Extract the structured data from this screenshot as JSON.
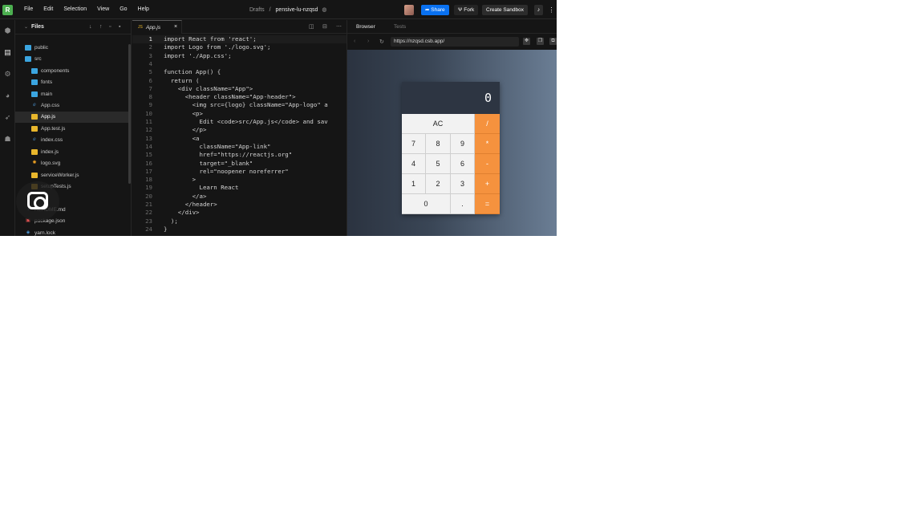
{
  "menubar": {
    "logo": "R",
    "menu": [
      "File",
      "Edit",
      "Selection",
      "View",
      "Go",
      "Help"
    ],
    "folder": "Drafts",
    "separator": "/",
    "sandbox_name": "pensive-lu-nzqsd",
    "share_label": "Share",
    "fork_label": "Fork",
    "create_label": "Create Sandbox"
  },
  "explorer": {
    "title": "Files",
    "items": [
      {
        "label": "public",
        "type": "folder"
      },
      {
        "label": "src",
        "type": "folder"
      },
      {
        "label": "components",
        "type": "folder"
      },
      {
        "label": "fonts",
        "type": "folder"
      },
      {
        "label": "main",
        "type": "folder"
      },
      {
        "label": "App.css",
        "type": "css"
      },
      {
        "label": "App.js",
        "type": "js"
      },
      {
        "label": "App.test.js",
        "type": "js"
      },
      {
        "label": "index.css",
        "type": "css"
      },
      {
        "label": "index.js",
        "type": "js"
      },
      {
        "label": "logo.svg",
        "type": "svg"
      },
      {
        "label": "serviceWorker.js",
        "type": "js"
      },
      {
        "label": "setupTests.js",
        "type": "js"
      },
      {
        "label": "README.md",
        "type": "md"
      },
      {
        "label": "package.json",
        "type": "json"
      },
      {
        "label": "yarn.lock",
        "type": "lock"
      }
    ]
  },
  "editor": {
    "tab_label": "App.js",
    "tab_badge": "JS",
    "code": [
      "import React from 'react';",
      "import Logo from './logo.svg';",
      "import './App.css';",
      "",
      "function App() {",
      "  return (",
      "    <div className=\"App\">",
      "      <header className=\"App-header\">",
      "        <img src={logo} className=\"App-logo\" a",
      "        <p>",
      "          Edit <code>src/App.js</code> and sav",
      "        </p>",
      "        <a",
      "          className=\"App-link\"",
      "          href=\"https://reactjs.org\"",
      "          target=\"_blank\"",
      "          rel=\"noopener noreferrer\"",
      "        >",
      "          Learn React",
      "        </a>",
      "      </header>",
      "    </div>",
      "  );",
      "}"
    ]
  },
  "browser": {
    "tab_browser": "Browser",
    "tab_tests": "Tests",
    "url": "https://nzqsd.csb.app/"
  },
  "calculator": {
    "display": "0",
    "keys": [
      {
        "label": "AC",
        "kind": "fn"
      },
      {
        "label": "/",
        "kind": "op"
      },
      {
        "label": "7",
        "kind": "num"
      },
      {
        "label": "8",
        "kind": "num"
      },
      {
        "label": "9",
        "kind": "num"
      },
      {
        "label": "*",
        "kind": "op"
      },
      {
        "label": "4",
        "kind": "num"
      },
      {
        "label": "5",
        "kind": "num"
      },
      {
        "label": "6",
        "kind": "num"
      },
      {
        "label": "-",
        "kind": "op"
      },
      {
        "label": "1",
        "kind": "num"
      },
      {
        "label": "2",
        "kind": "num"
      },
      {
        "label": "3",
        "kind": "num"
      },
      {
        "label": "+",
        "kind": "op"
      },
      {
        "label": "0",
        "kind": "num"
      },
      {
        "label": ".",
        "kind": "num"
      },
      {
        "label": "=",
        "kind": "op"
      }
    ],
    "operator_color": "#f5923e",
    "display_bg": "#2d3542"
  }
}
